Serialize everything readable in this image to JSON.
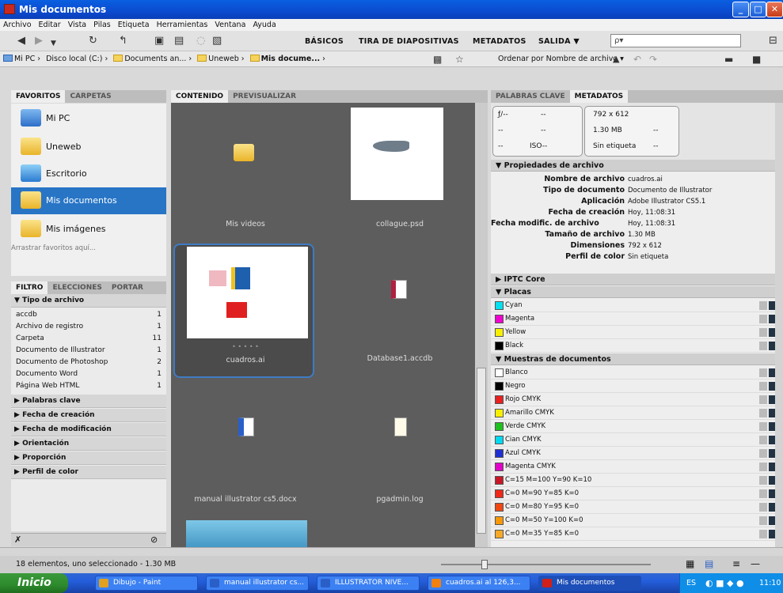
{
  "window": {
    "title": "Mis documentos"
  },
  "menu": [
    "Archivo",
    "Editar",
    "Vista",
    "Pilas",
    "Etiqueta",
    "Herramientas",
    "Ventana",
    "Ayuda"
  ],
  "workspaces": [
    "BÁSICOS",
    "TIRA DE DIAPOSITIVAS",
    "METADATOS",
    "SALIDA ▼"
  ],
  "search": {
    "placeholder": "ρ▾"
  },
  "path": [
    "Mi PC",
    "Disco local (C:)",
    "Documents an...",
    "Uneweb",
    "Mis docume..."
  ],
  "sort_label": "Ordenar por Nombre de archivo ▾",
  "left_tabs": {
    "fav": "FAVORITOS",
    "folders": "CARPETAS"
  },
  "favorites": [
    {
      "label": "Mi PC",
      "icon": "computer-icon"
    },
    {
      "label": "Uneweb",
      "icon": "folder-icon"
    },
    {
      "label": "Escritorio",
      "icon": "desktop-icon"
    },
    {
      "label": "Mis documentos",
      "icon": "folder-icon",
      "selected": true
    },
    {
      "label": "Mis imágenes",
      "icon": "pictures-folder-icon"
    }
  ],
  "drag_hint": "Arrastrar favoritos aquí...",
  "filter_tabs": {
    "filter": "FILTRO",
    "collections": "ELECCIONES",
    "export": "PORTAR"
  },
  "filter": {
    "file_type_header": "Tipo de archivo",
    "file_types": [
      {
        "name": "accdb",
        "count": "1"
      },
      {
        "name": "Archivo de registro",
        "count": "1"
      },
      {
        "name": "Carpeta",
        "count": "11"
      },
      {
        "name": "Documento de Illustrator",
        "count": "1"
      },
      {
        "name": "Documento de Photoshop",
        "count": "2"
      },
      {
        "name": "Documento Word",
        "count": "1"
      },
      {
        "name": "Página Web HTML",
        "count": "1"
      }
    ],
    "sections": [
      "Palabras clave",
      "Fecha de creación",
      "Fecha de modificación",
      "Orientación",
      "Proporción",
      "Perfil de color"
    ]
  },
  "content_tabs": {
    "content": "CONTENIDO",
    "preview": "PREVISUALIZAR"
  },
  "items": [
    {
      "name": "Mis videos",
      "icon": "video-folder-icon"
    },
    {
      "name": "collague.psd",
      "icon": "shark-thumbnail"
    },
    {
      "name": "cuadros.ai",
      "icon": "cuadros-thumbnail",
      "selected": true
    },
    {
      "name": "Database1.accdb",
      "icon": "access-db-icon"
    },
    {
      "name": "manual illustrator cs5.docx",
      "icon": "word-doc-icon"
    },
    {
      "name": "pgadmin.log",
      "icon": "log-file-icon"
    }
  ],
  "rating_dots": "• • • • •",
  "right_tabs": {
    "keywords": "PALABRAS CLAVE",
    "metadata": "METADATOS"
  },
  "meta_summary": {
    "fstop": "ƒ/--",
    "dash1": "--",
    "dash2": "--",
    "dash3": "--",
    "dash4": "--",
    "iso": "ISO--",
    "dims": "792 x 612",
    "size": "1.30 MB",
    "label": "Sin etiqueta",
    "dash5": "--",
    "dash6": "--"
  },
  "file_props_header": "Propiedades de archivo",
  "file_props": [
    {
      "k": "Nombre de archivo",
      "v": "cuadros.ai"
    },
    {
      "k": "Tipo de documento",
      "v": "Documento de Illustrator"
    },
    {
      "k": "Aplicación",
      "v": "Adobe Illustrator CS5.1"
    },
    {
      "k": "Fecha de creación",
      "v": "Hoy, 11:08:31"
    },
    {
      "k": "Fecha modific. de archivo",
      "v": "Hoy, 11:08:31"
    },
    {
      "k": "Tamaño de archivo",
      "v": "1.30 MB"
    },
    {
      "k": "Dimensiones",
      "v": "792 x 612"
    },
    {
      "k": "Perfil de color",
      "v": "Sin etiqueta"
    }
  ],
  "iptc_header": "IPTC Core",
  "plates_header": "Placas",
  "plates": [
    {
      "name": "Cyan",
      "color": "#00e0f0"
    },
    {
      "name": "Magenta",
      "color": "#f000d0"
    },
    {
      "name": "Yellow",
      "color": "#f8f000"
    },
    {
      "name": "Black",
      "color": "#000000"
    }
  ],
  "swatches_header": "Muestras de documentos",
  "swatches": [
    {
      "name": "Blanco",
      "color": "#ffffff"
    },
    {
      "name": "Negro",
      "color": "#000000"
    },
    {
      "name": "Rojo CMYK",
      "color": "#e82020"
    },
    {
      "name": "Amarillo CMYK",
      "color": "#f8f000"
    },
    {
      "name": "Verde CMYK",
      "color": "#20c020"
    },
    {
      "name": "Cian CMYK",
      "color": "#00d8f0"
    },
    {
      "name": "Azul CMYK",
      "color": "#2030d0"
    },
    {
      "name": "Magenta CMYK",
      "color": "#e000c8"
    },
    {
      "name": "C=15 M=100 Y=90 K=10",
      "color": "#c81828"
    },
    {
      "name": "C=0 M=90 Y=85 K=0",
      "color": "#f02818"
    },
    {
      "name": "C=0 M=80 Y=95 K=0",
      "color": "#f04810"
    },
    {
      "name": "C=0 M=50 Y=100 K=0",
      "color": "#f89808"
    },
    {
      "name": "C=0 M=35 Y=85 K=0",
      "color": "#f8a828"
    }
  ],
  "status": "18 elementos, uno seleccionado - 1.30 MB",
  "taskbar": {
    "start": "Inicio",
    "tasks": [
      {
        "label": "Dibujo - Paint",
        "color": "#e0a020"
      },
      {
        "label": "manual illustrator cs...",
        "color": "#2a5fc8"
      },
      {
        "label": "ILLUSTRATOR NIVE...",
        "color": "#2a5fc8"
      },
      {
        "label": "cuadros.ai al 126,3...",
        "color": "#f08010"
      },
      {
        "label": "Mis documentos",
        "color": "#d02018"
      }
    ],
    "lang": "ES",
    "clock": "11:10"
  }
}
